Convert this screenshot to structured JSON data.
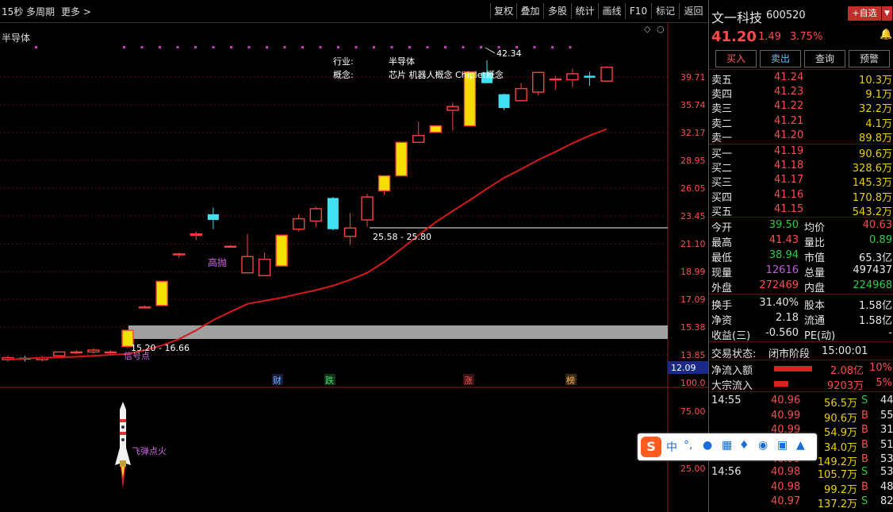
{
  "topbar": {
    "period": "15秒",
    "multi": "多周期",
    "more": "更多 >",
    "buttons": [
      "复权",
      "叠加",
      "多股",
      "统计",
      "画线",
      "F10",
      "标记",
      "返回"
    ]
  },
  "chart": {
    "indicator_label": "半导体",
    "industry_label": "行业:",
    "industry_value": "半导体",
    "concept_label": "概念:",
    "concept_value": "芯片 机器人概念 Chiplet概念",
    "peak_label": "42.34",
    "zone1_label": "25.58 - 25.80",
    "zone2_label": "15.20 - 16.66",
    "gaopao": "高抛",
    "signal": "信号点",
    "rocket_label": "飞弹点火",
    "events": [
      "财",
      "跌",
      "涨",
      "榜"
    ],
    "price_ticks": [
      "39.71",
      "35.74",
      "32.17",
      "28.95",
      "26.05",
      "23.45",
      "21.10",
      "18.99",
      "17.09",
      "15.38",
      "13.85"
    ],
    "current_price_tag": "12.09",
    "sub_ticks": [
      "100.0",
      "75.00",
      "50.00",
      "25.00"
    ]
  },
  "chart_data": {
    "type": "candlestick",
    "ylim": [
      13.0,
      42.5
    ],
    "log_scale": true,
    "candles": [
      {
        "o": 13.6,
        "h": 13.8,
        "l": 13.5,
        "c": 13.7
      },
      {
        "o": 13.7,
        "h": 13.8,
        "l": 13.5,
        "c": 13.6
      },
      {
        "o": 13.6,
        "h": 13.8,
        "l": 13.5,
        "c": 13.7
      },
      {
        "o": 13.8,
        "h": 14.0,
        "l": 13.7,
        "c": 14.0
      },
      {
        "o": 14.0,
        "h": 14.1,
        "l": 13.9,
        "c": 14.0
      },
      {
        "o": 14.0,
        "h": 14.2,
        "l": 13.9,
        "c": 14.1
      },
      {
        "o": 14.0,
        "h": 14.1,
        "l": 13.9,
        "c": 14.0
      },
      {
        "o": 14.3,
        "h": 15.2,
        "l": 14.2,
        "c": 15.2
      },
      {
        "o": 16.6,
        "h": 16.7,
        "l": 16.6,
        "c": 16.6
      },
      {
        "o": 16.7,
        "h": 18.3,
        "l": 16.7,
        "c": 18.3
      },
      {
        "o": 20.3,
        "h": 20.4,
        "l": 20.0,
        "c": 20.3
      },
      {
        "o": 21.8,
        "h": 22.1,
        "l": 21.4,
        "c": 21.9
      },
      {
        "o": 23.6,
        "h": 24.2,
        "l": 22.3,
        "c": 23.1
      },
      {
        "o": 20.9,
        "h": 21.0,
        "l": 20.9,
        "c": 20.9
      },
      {
        "o": 18.9,
        "h": 21.9,
        "l": 18.9,
        "c": 20.1
      },
      {
        "o": 18.7,
        "h": 20.4,
        "l": 18.7,
        "c": 19.9
      },
      {
        "o": 19.4,
        "h": 21.8,
        "l": 19.4,
        "c": 21.8
      },
      {
        "o": 22.3,
        "h": 23.6,
        "l": 22.1,
        "c": 23.2
      },
      {
        "o": 23.0,
        "h": 24.3,
        "l": 22.5,
        "c": 24.1
      },
      {
        "o": 25.1,
        "h": 25.2,
        "l": 22.2,
        "c": 22.3
      },
      {
        "o": 21.7,
        "h": 23.7,
        "l": 21.0,
        "c": 22.4
      },
      {
        "o": 23.1,
        "h": 25.5,
        "l": 22.5,
        "c": 25.2
      },
      {
        "o": 25.8,
        "h": 27.3,
        "l": 25.4,
        "c": 27.3
      },
      {
        "o": 27.3,
        "h": 31.0,
        "l": 27.3,
        "c": 31.0
      },
      {
        "o": 31.0,
        "h": 33.5,
        "l": 31.0,
        "c": 31.8
      },
      {
        "o": 32.2,
        "h": 33.0,
        "l": 32.1,
        "c": 33.0
      },
      {
        "o": 35.0,
        "h": 36.0,
        "l": 32.4,
        "c": 35.5
      },
      {
        "o": 33.0,
        "h": 40.5,
        "l": 33.0,
        "c": 40.5
      },
      {
        "o": 40.4,
        "h": 42.3,
        "l": 38.8,
        "c": 38.8
      },
      {
        "o": 37.2,
        "h": 37.3,
        "l": 35.0,
        "c": 35.3
      },
      {
        "o": 36.3,
        "h": 38.8,
        "l": 36.3,
        "c": 38.0
      },
      {
        "o": 37.5,
        "h": 40.5,
        "l": 37.0,
        "c": 40.4
      },
      {
        "o": 39.4,
        "h": 39.9,
        "l": 37.8,
        "c": 39.4
      },
      {
        "o": 39.3,
        "h": 41.0,
        "l": 38.2,
        "c": 40.2
      },
      {
        "o": 39.9,
        "h": 40.5,
        "l": 38.4,
        "c": 39.6
      },
      {
        "o": 39.1,
        "h": 41.4,
        "l": 39.0,
        "c": 41.2
      }
    ],
    "ma": [
      13.6,
      13.65,
      13.7,
      13.72,
      13.75,
      13.8,
      13.85,
      13.9,
      14.1,
      14.35,
      14.7,
      15.2,
      15.8,
      16.3,
      16.8,
      17.0,
      17.2,
      17.45,
      17.7,
      18.0,
      18.4,
      18.9,
      19.7,
      20.7,
      21.8,
      22.9,
      23.9,
      24.9,
      26.0,
      27.1,
      28.0,
      29.0,
      29.9,
      30.9,
      31.8,
      32.6
    ]
  },
  "panel": {
    "name": "文一科技",
    "code": "600520",
    "add_btn": "+自选",
    "price": "41.20",
    "change": "1.49",
    "pct": "3.75%",
    "buttons": [
      "买入",
      "卖出",
      "查询",
      "预警"
    ],
    "asks": [
      {
        "label": "卖五",
        "price": "41.24",
        "vol": "10.3万"
      },
      {
        "label": "卖四",
        "price": "41.23",
        "vol": "9.1万"
      },
      {
        "label": "卖三",
        "price": "41.22",
        "vol": "32.2万"
      },
      {
        "label": "卖二",
        "price": "41.21",
        "vol": "4.1万"
      },
      {
        "label": "卖一",
        "price": "41.20",
        "vol": "89.8万"
      }
    ],
    "bids": [
      {
        "label": "买一",
        "price": "41.19",
        "vol": "90.6万"
      },
      {
        "label": "买二",
        "price": "41.18",
        "vol": "328.6万"
      },
      {
        "label": "买三",
        "price": "41.17",
        "vol": "145.3万"
      },
      {
        "label": "买四",
        "price": "41.16",
        "vol": "170.8万"
      },
      {
        "label": "买五",
        "price": "41.15",
        "vol": "543.2万"
      }
    ],
    "stats": [
      {
        "l1": "今开",
        "v1": "39.50",
        "l2": "均价",
        "v2": "40.63"
      },
      {
        "l1": "最高",
        "v1": "41.43",
        "l2": "量比",
        "v2": "0.89"
      },
      {
        "l1": "最低",
        "v1": "38.94",
        "l2": "市值",
        "v2": "65.3亿"
      },
      {
        "l1": "现量",
        "v1": "12616",
        "l2": "总量",
        "v2": "497437"
      },
      {
        "l1": "外盘",
        "v1": "272469",
        "l2": "内盘",
        "v2": "224968"
      }
    ],
    "stats2": [
      {
        "l1": "换手",
        "v1": "31.40%",
        "l2": "股本",
        "v2": "1.58亿"
      },
      {
        "l1": "净资",
        "v1": "2.18",
        "l2": "流通",
        "v2": "1.58亿"
      },
      {
        "l1": "收益(三)",
        "v1": "-0.560",
        "l2": "PE(动)",
        "v2": "-"
      }
    ],
    "trade_status_label": "交易状态:",
    "trade_status": "闭市阶段",
    "trade_time": "15:00:01",
    "flow": [
      {
        "label": "净流入额",
        "value": "2.08亿",
        "pct": "10%",
        "fill": 0.8
      },
      {
        "label": "大宗流入",
        "value": "9203万",
        "pct": "5%",
        "fill": 0.3
      }
    ],
    "ticks": [
      {
        "time": "14:55",
        "price": "40.96",
        "vol": "56.5万",
        "side": "S",
        "cnt": "44"
      },
      {
        "time": "",
        "price": "40.99",
        "vol": "90.6万",
        "side": "B",
        "cnt": "55"
      },
      {
        "time": "",
        "price": "40.99",
        "vol": "54.9万",
        "side": "B",
        "cnt": "31"
      },
      {
        "time": "",
        "price": "40.99",
        "vol": "34.0万",
        "side": "B",
        "cnt": "51"
      },
      {
        "time": "",
        "price": "40.99",
        "vol": "149.2万",
        "side": "B",
        "cnt": "53"
      },
      {
        "time": "14:56",
        "price": "40.98",
        "vol": "105.7万",
        "side": "S",
        "cnt": "53"
      },
      {
        "time": "",
        "price": "40.98",
        "vol": "99.2万",
        "side": "B",
        "cnt": "48"
      },
      {
        "time": "",
        "price": "40.97",
        "vol": "137.2万",
        "side": "S",
        "cnt": "82"
      }
    ]
  },
  "ime": {
    "logo": "S",
    "lang": "中",
    "punct": "°,"
  }
}
